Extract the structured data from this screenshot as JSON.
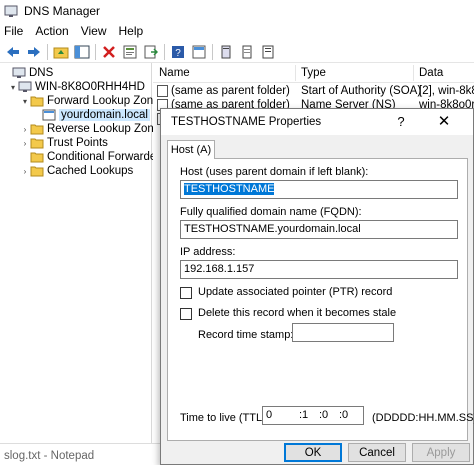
{
  "window": {
    "title": "DNS Manager"
  },
  "menu": {
    "items": [
      "File",
      "Action",
      "View",
      "Help"
    ]
  },
  "tree": {
    "root": "DNS",
    "server": "WIN-8K8O0RHH4HD",
    "forward_zones": "Forward Lookup Zones",
    "zone": "yourdomain.local",
    "reverse_zones": "Reverse Lookup Zones",
    "trust_points": "Trust Points",
    "conditional_forwarders": "Conditional Forwarders",
    "cached_lookups": "Cached Lookups"
  },
  "list": {
    "columns": [
      "Name",
      "Type",
      "Data"
    ],
    "rows": [
      {
        "name": "(same as parent folder)",
        "type": "Start of Authority (SOA)",
        "data": "[2], win-8k8o"
      },
      {
        "name": "(same as parent folder)",
        "type": "Name Server (NS)",
        "data": "win-8k8o0rh"
      }
    ]
  },
  "statusbar": {
    "text": "slog.txt - Notepad"
  },
  "dialog": {
    "title": "TESTHOSTNAME Properties",
    "help_label": "?",
    "close_label": "✕",
    "tab": "Host (A)",
    "host_label": "Host (uses parent domain if left blank):",
    "host_value": "TESTHOSTNAME",
    "fqdn_label": "Fully qualified domain name (FQDN):",
    "fqdn_value": "TESTHOSTNAME.yourdomain.local",
    "ip_label": "IP address:",
    "ip_value": "192.168.1.157",
    "ptr_label": "Update associated pointer (PTR) record",
    "stale_label": "Delete this record when it becomes stale",
    "timestamp_label": "Record time stamp:",
    "ttl_label": "Time to live (TTL):",
    "ttl_days": "0",
    "ttl_hours": ":1",
    "ttl_minutes": ":0",
    "ttl_seconds": ":0",
    "ttl_format": "(DDDDD:HH.MM.SS)",
    "ok_label": "OK",
    "cancel_label": "Cancel",
    "apply_label": "Apply"
  }
}
